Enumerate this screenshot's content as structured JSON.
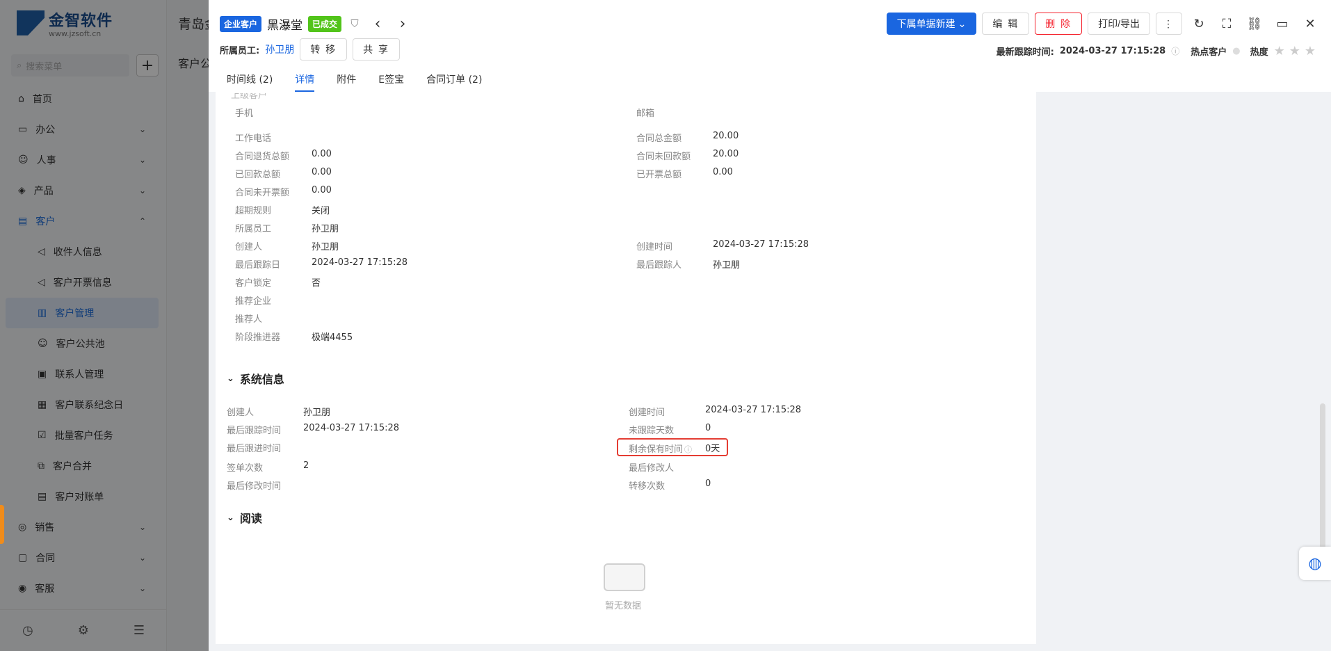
{
  "sidebar": {
    "logo_cn": "金智软件",
    "logo_url": "www.jzsoft.cn",
    "search_placeholder": "搜索菜单",
    "items": [
      {
        "label": "首页",
        "icon": "home-icon",
        "has_chevron": false
      },
      {
        "label": "办公",
        "icon": "monitor-icon",
        "has_chevron": true
      },
      {
        "label": "人事",
        "icon": "people-icon",
        "has_chevron": true
      },
      {
        "label": "产品",
        "icon": "cube-icon",
        "has_chevron": true
      },
      {
        "label": "客户",
        "icon": "customer-icon",
        "has_chevron": true,
        "open": true
      }
    ],
    "sub_items": [
      "收件人信息",
      "客户开票信息",
      "客户管理",
      "客户公共池",
      "联系人管理",
      "客户联系纪念日",
      "批量客户任务",
      "客户合并",
      "客户对账单"
    ],
    "active_sub": "客户管理",
    "items_after": [
      {
        "label": "销售",
        "icon": "sales-icon"
      },
      {
        "label": "合同",
        "icon": "contract-icon"
      },
      {
        "label": "客服",
        "icon": "service-icon"
      }
    ]
  },
  "background": {
    "title": "青岛金",
    "subtitle": "客户公"
  },
  "header": {
    "tag_type": "企业客户",
    "customer_name": "黑瀑堂",
    "tag_status": "已成交",
    "owner_label": "所属员工:",
    "owner_name": "孙卫朋",
    "transfer_label": "转 移",
    "share_label": "共 享",
    "new_sub_label": "下属单据新建",
    "edit_label": "编 辑",
    "delete_label": "删 除",
    "print_label": "打印/导出",
    "last_follow_label": "最新跟踪时间:",
    "last_follow_time": "2024-03-27 17:15:28",
    "hot_label": "热点客户",
    "heat_label": "热度"
  },
  "tabs": [
    {
      "label": "时间线 (2)",
      "active": false
    },
    {
      "label": "详情",
      "active": true
    },
    {
      "label": "附件",
      "active": false
    },
    {
      "label": "E签宝",
      "active": false
    },
    {
      "label": "合同订单 (2)",
      "active": false
    }
  ],
  "details": {
    "partial_top_label": "上级客户",
    "left": [
      {
        "label": "手机",
        "value": ""
      },
      {
        "label": "工作电话",
        "value": ""
      },
      {
        "label": "合同退货总额",
        "value": "0.00"
      },
      {
        "label": "已回款总额",
        "value": "0.00"
      },
      {
        "label": "合同未开票额",
        "value": "0.00"
      },
      {
        "label": "超期规则",
        "value": "关闭"
      },
      {
        "label": "所属员工",
        "value": "孙卫朋"
      },
      {
        "label": "创建人",
        "value": "孙卫朋"
      },
      {
        "label": "最后跟踪日",
        "value": "2024-03-27 17:15:28"
      },
      {
        "label": "客户锁定",
        "value": "否"
      },
      {
        "label": "推荐企业",
        "value": ""
      },
      {
        "label": "推荐人",
        "value": ""
      },
      {
        "label": "阶段推进器",
        "value": "极端4455"
      }
    ],
    "right": [
      {
        "label": "邮箱",
        "value": ""
      },
      {
        "label": "合同总金额",
        "value": "20.00"
      },
      {
        "label": "合同未回款额",
        "value": "20.00"
      },
      {
        "label": "已开票总额",
        "value": "0.00"
      },
      {
        "label": "创建时间",
        "value": "2024-03-27 17:15:28"
      },
      {
        "label": "最后跟踪人",
        "value": "孙卫朋"
      }
    ]
  },
  "system_info": {
    "title": "系统信息",
    "left": [
      {
        "label": "创建人",
        "value": "孙卫朋"
      },
      {
        "label": "最后跟踪时间",
        "value": "2024-03-27 17:15:28"
      },
      {
        "label": "最后跟进时间",
        "value": ""
      },
      {
        "label": "签单次数",
        "value": "2"
      },
      {
        "label": "最后修改时间",
        "value": ""
      }
    ],
    "right": [
      {
        "label": "创建时间",
        "value": "2024-03-27 17:15:28"
      },
      {
        "label": "未跟踪天数",
        "value": "0"
      },
      {
        "label": "剩余保有时间",
        "value": "0天"
      },
      {
        "label": "最后修改人",
        "value": ""
      },
      {
        "label": "转移次数",
        "value": "0"
      }
    ]
  },
  "reading": {
    "title": "阅读",
    "empty_text": "暂无数据"
  },
  "colors": {
    "primary": "#1a66e0",
    "success": "#52c41a",
    "danger": "#f5222d",
    "highlight_border": "#e43d33"
  }
}
